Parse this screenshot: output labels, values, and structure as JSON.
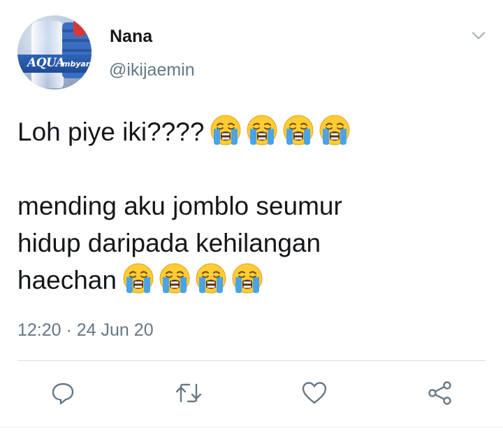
{
  "tweet": {
    "author_name": "Nana",
    "handle": "@ikijaemin",
    "avatar": {
      "logo_text": "AQUA",
      "logo_suffix": "mbyar"
    },
    "lines": [
      "Loh piye iki????",
      "",
      "mending aku jomblo seumur",
      "hidup daripada kehilangan",
      "haechan"
    ],
    "emoji": "loudly-crying-face",
    "emoji_counts": [
      4,
      0,
      0,
      0,
      4
    ],
    "timestamp": "12:20 · 24 Jun 20"
  },
  "actions": [
    {
      "name": "reply",
      "icon": "reply-icon"
    },
    {
      "name": "retweet",
      "icon": "retweet-icon"
    },
    {
      "name": "like",
      "icon": "heart-icon"
    },
    {
      "name": "share",
      "icon": "share-icon"
    }
  ],
  "colors": {
    "primary_text": "#14171a",
    "secondary_text": "#657786",
    "icon": "#657786",
    "divider": "#d4dbe1"
  }
}
